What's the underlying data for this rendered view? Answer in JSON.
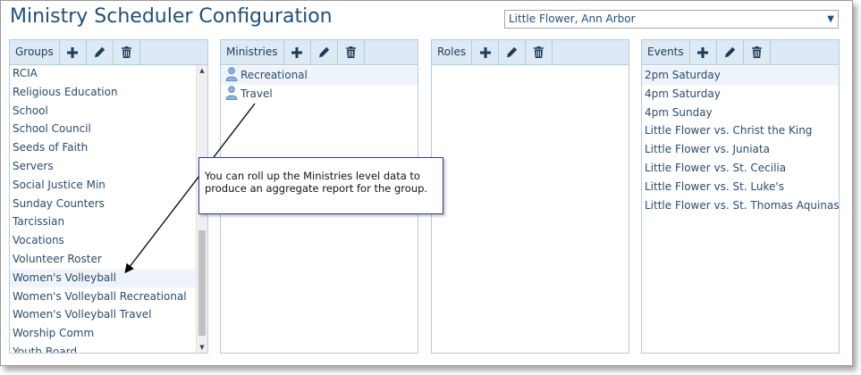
{
  "app": {
    "title": "Ministry Scheduler Configuration",
    "parish_selected": "Little Flower, Ann Arbor",
    "parish_dropdown_arrow": "▼"
  },
  "panels": {
    "groups": {
      "label": "Groups",
      "items": [
        "RCIA",
        "Religious Education",
        "School",
        "School Council",
        "Seeds of Faith",
        "Servers",
        "Social Justice Min",
        "Sunday Counters",
        "Tarcissian",
        "Vocations",
        "Volunteer Roster",
        "Women's Volleyball",
        "Women's Volleyball Recreational",
        "Women's Volleyball Travel",
        "Worship Comm",
        "Youth Board"
      ],
      "selected_index": 11
    },
    "ministries": {
      "label": "Ministries",
      "items": [
        "Recreational",
        "Travel"
      ],
      "selected_index": 0
    },
    "roles": {
      "label": "Roles",
      "items": []
    },
    "events": {
      "label": "Events",
      "items": [
        "2pm Saturday",
        "4pm Saturday",
        "4pm Sunday",
        "Little Flower vs. Christ the King",
        "Little Flower vs. Juniata",
        "Little Flower vs. St. Cecilia",
        "Little Flower vs. St. Luke's",
        "Little Flower vs. St. Thomas Aquinas"
      ],
      "selected_index": 0
    }
  },
  "callout": {
    "text": "You can roll up the Ministries level data to produce an aggregate report for the group."
  },
  "icons": {
    "add": "plus-icon",
    "edit": "pencil-icon",
    "delete": "trash-icon",
    "ministry": "person-icon"
  },
  "colors": {
    "title": "#1e4f7c",
    "header_bg": "#dde9f5",
    "border": "#b5cbe0",
    "icon": "#1f3b57",
    "selection": "#eef4fa",
    "callout_border": "#2b3e9a"
  }
}
